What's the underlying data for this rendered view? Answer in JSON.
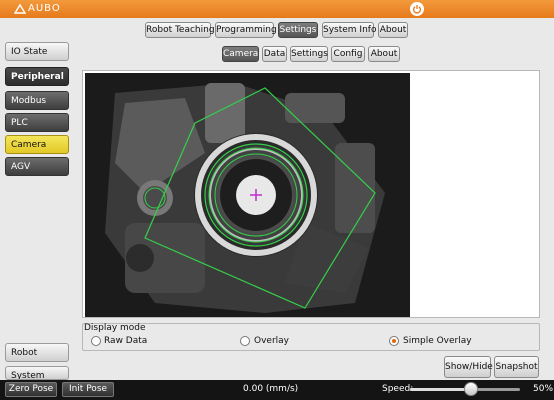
{
  "header": {
    "logo_text": "AUBO"
  },
  "main_tabs": [
    {
      "label": "Robot Teaching",
      "active": false
    },
    {
      "label": "Programming",
      "active": false
    },
    {
      "label": "Settings",
      "active": true
    },
    {
      "label": "System Info",
      "active": false
    },
    {
      "label": "About",
      "active": false
    }
  ],
  "sub_tabs": [
    {
      "label": "Camera",
      "active": true
    },
    {
      "label": "Data",
      "active": false
    },
    {
      "label": "Settings",
      "active": false
    },
    {
      "label": "Config",
      "active": false
    },
    {
      "label": "About",
      "active": false
    }
  ],
  "sidebar": {
    "items": [
      {
        "label": "IO State"
      },
      {
        "label": "Peripheral"
      },
      {
        "label": "Modbus"
      },
      {
        "label": "PLC"
      },
      {
        "label": "Camera",
        "selected": true
      },
      {
        "label": "AGV"
      }
    ],
    "bottom_items": [
      {
        "label": "Robot"
      },
      {
        "label": "System"
      }
    ]
  },
  "display_mode": {
    "title": "Display mode",
    "options": [
      {
        "label": "Raw Data",
        "selected": false
      },
      {
        "label": "Overlay",
        "selected": false
      },
      {
        "label": "Simple Overlay",
        "selected": true
      }
    ]
  },
  "actions": {
    "show_hide": "Show/Hide",
    "snapshot": "Snapshot"
  },
  "footer": {
    "zero_pose": "Zero Pose",
    "init_pose": "Init Pose",
    "speed_readout": "0.00 (mm/s)",
    "speed_label": "Speed:",
    "speed_percent": "50%",
    "speed_value": 0.5
  },
  "colors": {
    "accent": "#e67a1c",
    "overlay_green": "#35d04a",
    "marker": "#c02fd0"
  }
}
